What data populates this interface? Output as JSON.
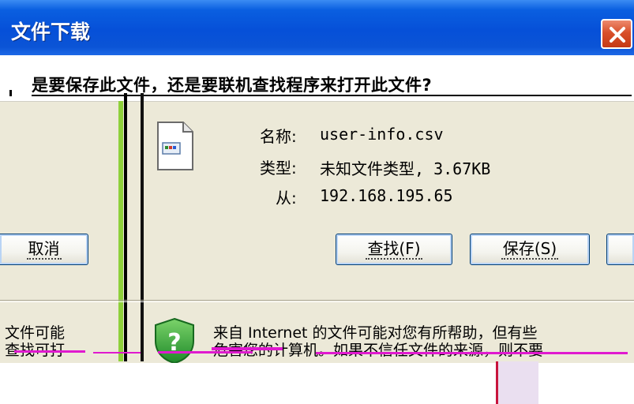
{
  "dialog": {
    "title": "文件下载",
    "question": "是要保存此文件，还是要联机查找程序来打开此文件?"
  },
  "file": {
    "name_label": "名称:",
    "name_value": "user-info.csv",
    "type_label": "类型:",
    "type_value": "未知文件类型, 3.67KB",
    "from_label": "从:",
    "from_value": "192.168.195.65",
    "icon": "file-icon"
  },
  "buttons": {
    "cancel": "取消",
    "find": "查找(F)",
    "save": "保存(S)"
  },
  "warning": {
    "left_line1": "文件可能",
    "left_line2": "查找可打",
    "line1": "来自 Internet 的文件可能对您有所帮助，但有些",
    "line2": "危害您的计算机。如果不信任文件的来源，则不要"
  },
  "colors": {
    "titlebar": "#0A5FE0",
    "close": "#D8502B",
    "face": "#ECE9D8"
  }
}
